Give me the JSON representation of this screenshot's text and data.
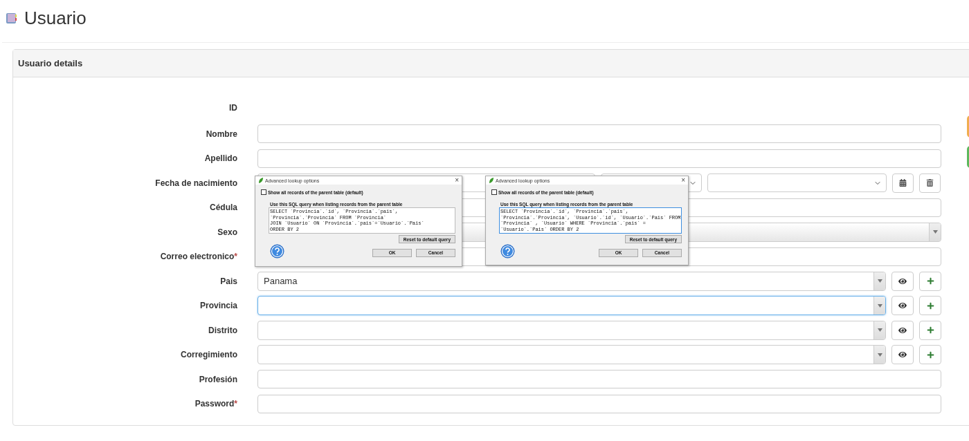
{
  "page": {
    "title": "Usuario"
  },
  "panel": {
    "title": "Usuario details"
  },
  "fields": [
    {
      "label": "ID",
      "kind": "static"
    },
    {
      "label": "Nombre",
      "kind": "text"
    },
    {
      "label": "Apellido",
      "kind": "text"
    },
    {
      "label": "Fecha de nacimiento",
      "kind": "date"
    },
    {
      "label": "Cédula",
      "kind": "text"
    },
    {
      "label": "Sexo",
      "kind": "select"
    },
    {
      "label": "Correo electronico",
      "kind": "text",
      "required_mark": "*"
    },
    {
      "label": "Pais",
      "kind": "lookup",
      "value": "Panama",
      "focused": false
    },
    {
      "label": "Provincia",
      "kind": "lookup",
      "focused": true
    },
    {
      "label": "Distrito",
      "kind": "lookup",
      "focused": false
    },
    {
      "label": "Corregimiento",
      "kind": "lookup",
      "focused": false
    },
    {
      "label": "Profesión",
      "kind": "text"
    },
    {
      "label": "Password",
      "kind": "text",
      "required_mark": "*"
    }
  ],
  "side_buttons": [
    {
      "color": "#f0ad4e"
    },
    {
      "color": "#5cb85c"
    }
  ],
  "dialogs": [
    {
      "title": "Advanced lookup options",
      "close": "×",
      "checkbox": {
        "label": "Show all records of the parent table (default)",
        "checked": false
      },
      "query_label": "Use this SQL query when listing records from the parent table",
      "query": "SELECT `Provincia`.`id`, `Provincia`.`pais`,\n`Provincia`.`Provincia` FROM `Provincia`\nJOIN `Usuario` ON `Provincia`.`pais`=`Usuario`.`Pais`\nORDER BY 2",
      "focused": false,
      "reset": "Reset to default query",
      "ok": "OK",
      "cancel": "Cancel"
    },
    {
      "title": "Advanced lookup options",
      "close": "×",
      "checkbox": {
        "label": "Show all records of the parent table (default)",
        "checked": false
      },
      "query_label": "Use this SQL query when listing records from the parent table",
      "query": "SELECT `Provincia`.`id`, `Provincia`.`pais`,\n`Provincia`.`Provincia`, `Usuario`.`id`, `Usuario`.`Pais` FROM\n`Provincia` , `Usuario` WHERE `Provincia`.`pais` =\n`Usuario`.`Pais` ORDER BY 2",
      "focused": true,
      "reset": "Reset to default query",
      "ok": "OK",
      "cancel": "Cancel"
    }
  ]
}
